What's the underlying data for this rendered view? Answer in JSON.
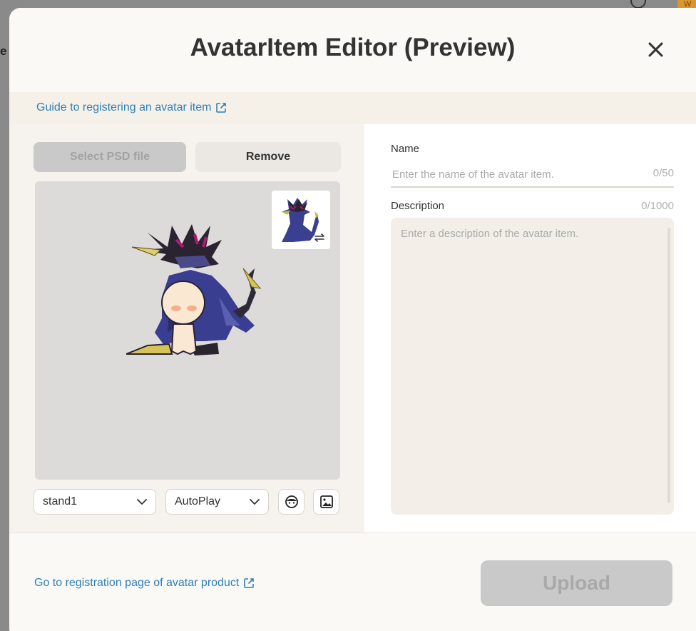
{
  "modal": {
    "title": "AvatarItem Editor (Preview)",
    "close_icon": "close-icon"
  },
  "guide": {
    "link_label": "Guide to registering an avatar item",
    "icon": "external-link-icon"
  },
  "left": {
    "select_psd_label": "Select PSD file",
    "remove_label": "Remove",
    "thumbnail_swap_icon": "swap-icon",
    "pose_select": {
      "value": "stand1",
      "icon": "chevron-down-icon"
    },
    "play_select": {
      "value": "AutoPlay",
      "icon": "chevron-down-icon"
    },
    "face_button_icon": "face-icon",
    "background_button_icon": "image-icon"
  },
  "right": {
    "name_label": "Name",
    "name_placeholder": "Enter the name of the avatar item.",
    "name_count": "0/50",
    "description_label": "Description",
    "description_count": "0/1000",
    "description_placeholder": "Enter a description of the avatar item."
  },
  "footer": {
    "registration_link_label": "Go to registration page of avatar product",
    "upload_label": "Upload"
  },
  "background": {
    "peek_text": "e",
    "avatar_initial": "W"
  },
  "colors": {
    "link": "#2f7fb5",
    "disabled_button": "#c9c9c9",
    "guide_bar": "#f6f1e8"
  }
}
